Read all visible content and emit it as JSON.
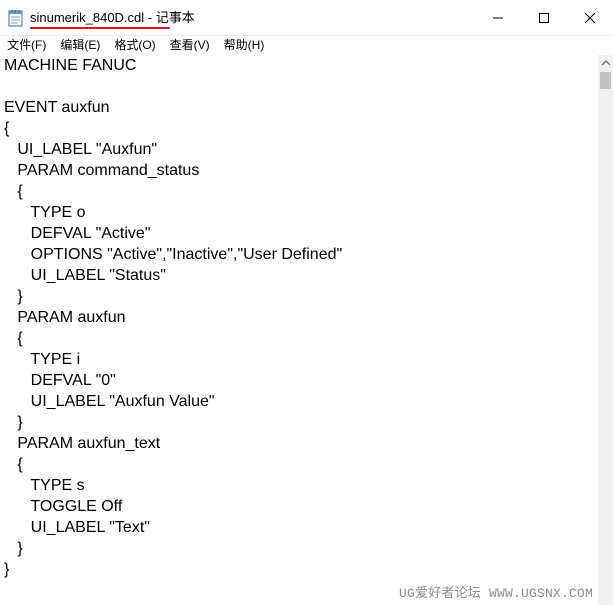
{
  "window": {
    "title": "sinumerik_840D.cdl - 记事本",
    "icons": {
      "app": "notepad-icon",
      "minimize": "minimize-icon",
      "maximize": "maximize-icon",
      "close": "close-icon"
    }
  },
  "menu": {
    "items": [
      "文件(F)",
      "编辑(E)",
      "格式(O)",
      "查看(V)",
      "帮助(H)"
    ]
  },
  "editor": {
    "lines": [
      "MACHINE FANUC",
      "",
      "EVENT auxfun",
      "{",
      "   UI_LABEL \"Auxfun\"",
      "   PARAM command_status",
      "   {",
      "      TYPE o",
      "      DEFVAL \"Active\"",
      "      OPTIONS \"Active\",\"Inactive\",\"User Defined\"",
      "      UI_LABEL \"Status\"",
      "   }",
      "   PARAM auxfun",
      "   {",
      "      TYPE i",
      "      DEFVAL \"0\"",
      "      UI_LABEL \"Auxfun Value\"",
      "   }",
      "   PARAM auxfun_text",
      "   {",
      "      TYPE s",
      "      TOGGLE Off",
      "      UI_LABEL \"Text\"",
      "   }",
      "}"
    ]
  },
  "watermark": "UG爱好者论坛 WWW.UGSNX.COM",
  "colors": {
    "underline": "#e81123",
    "scrollbar_track": "#f0f0f0",
    "scrollbar_thumb": "#c2c2c2"
  }
}
